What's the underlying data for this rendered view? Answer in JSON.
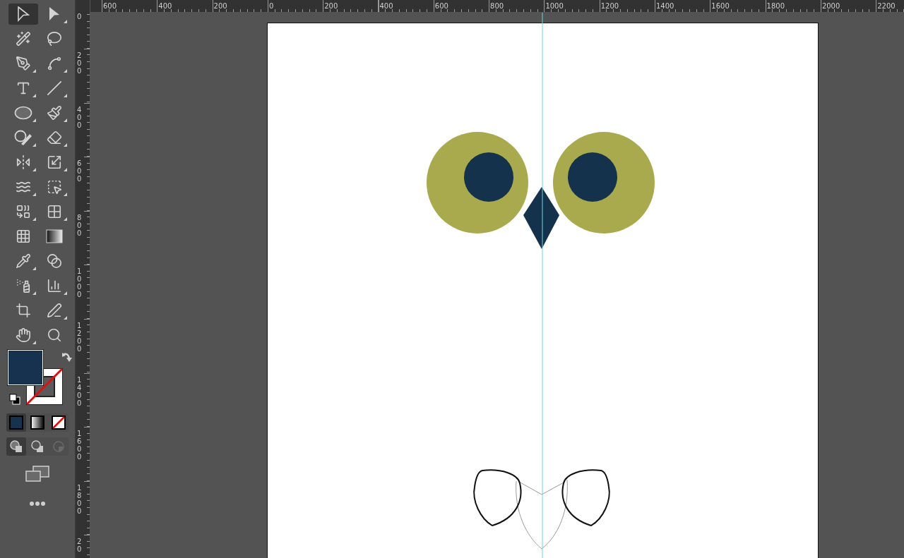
{
  "toolbar": {
    "tools": [
      {
        "kind": "selection",
        "selected": true,
        "flyout": false
      },
      {
        "kind": "direct-selection",
        "selected": false,
        "flyout": true
      },
      {
        "kind": "magic-wand",
        "selected": false,
        "flyout": false
      },
      {
        "kind": "lasso",
        "selected": false,
        "flyout": false
      },
      {
        "kind": "pen",
        "selected": false,
        "flyout": true
      },
      {
        "kind": "curvature",
        "selected": false,
        "flyout": true
      },
      {
        "kind": "type",
        "selected": false,
        "flyout": true
      },
      {
        "kind": "line",
        "selected": false,
        "flyout": true
      },
      {
        "kind": "ellipse",
        "selected": false,
        "flyout": true
      },
      {
        "kind": "paintbrush",
        "selected": false,
        "flyout": true
      },
      {
        "kind": "shaper",
        "selected": false,
        "flyout": true
      },
      {
        "kind": "eraser",
        "selected": false,
        "flyout": true
      },
      {
        "kind": "reflect",
        "selected": false,
        "flyout": true
      },
      {
        "kind": "scale",
        "selected": false,
        "flyout": true
      },
      {
        "kind": "warp",
        "selected": false,
        "flyout": true
      },
      {
        "kind": "free-transform",
        "selected": false,
        "flyout": true
      },
      {
        "kind": "shape-builder",
        "selected": false,
        "flyout": true
      },
      {
        "kind": "perspective-grid",
        "selected": false,
        "flyout": true
      },
      {
        "kind": "mesh",
        "selected": false,
        "flyout": false
      },
      {
        "kind": "gradient",
        "selected": false,
        "flyout": false
      },
      {
        "kind": "eyedropper",
        "selected": false,
        "flyout": true
      },
      {
        "kind": "blend",
        "selected": false,
        "flyout": false
      },
      {
        "kind": "symbol-sprayer",
        "selected": false,
        "flyout": true
      },
      {
        "kind": "graph",
        "selected": false,
        "flyout": true
      },
      {
        "kind": "artboard",
        "selected": false,
        "flyout": false
      },
      {
        "kind": "pencil",
        "selected": false,
        "flyout": true
      },
      {
        "kind": "hand",
        "selected": false,
        "flyout": true
      },
      {
        "kind": "zoom",
        "selected": false,
        "flyout": false
      }
    ],
    "color_modes": [
      {
        "kind": "color",
        "selected": true
      },
      {
        "kind": "gradient",
        "selected": false
      },
      {
        "kind": "none",
        "selected": false
      }
    ],
    "draw_modes": [
      {
        "kind": "normal",
        "selected": true
      },
      {
        "kind": "behind",
        "selected": false
      },
      {
        "kind": "inside",
        "selected": false,
        "disabled": true
      }
    ]
  },
  "rulers": {
    "horizontal": [
      "600",
      "400",
      "200",
      "0",
      "200",
      "400",
      "600",
      "800",
      "1000",
      "1200",
      "1400",
      "1600",
      "1800",
      "2000",
      "2200"
    ],
    "vertical": [
      "0",
      "200",
      "400",
      "600",
      "800",
      "1000",
      "1200",
      "1400",
      "1600",
      "1800",
      "20"
    ]
  }
}
